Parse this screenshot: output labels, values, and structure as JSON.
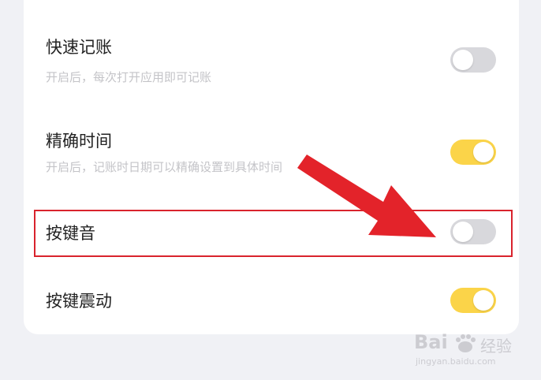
{
  "settings": {
    "items": [
      {
        "title": "快速记账",
        "desc": "开启后，每次打开应用即可记账",
        "enabled": false
      },
      {
        "title": "精确时间",
        "desc": "开启后，记账时日期可以精确设置到具体时间",
        "enabled": true
      },
      {
        "title": "按键音",
        "desc": "",
        "enabled": false
      },
      {
        "title": "按键震动",
        "desc": "",
        "enabled": true
      }
    ]
  },
  "annotation": {
    "highlight_color": "#d9232d",
    "arrow_color": "#e3232a"
  },
  "colors": {
    "toggle_on": "#fbd449",
    "toggle_off": "#d8d8dc"
  },
  "watermark": {
    "brand": "Bai",
    "brand_cn": "经验",
    "url": "jingyan.baidu.com"
  }
}
